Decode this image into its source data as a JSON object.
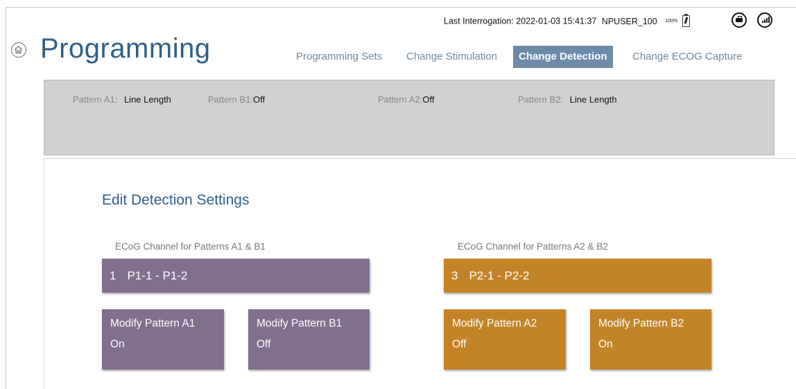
{
  "header": {
    "last_interrogation": "Last Interrogation: 2022-01-03 15:41:37",
    "user": "NPUSER_100",
    "battery_percent": "100%",
    "icons": [
      "toolbox-icon",
      "signal-icon",
      "home-icon",
      "battery-icon"
    ]
  },
  "page": {
    "title": "Programming"
  },
  "nav": {
    "tabs": [
      {
        "label": "Programming Sets",
        "active": false
      },
      {
        "label": "Change Stimulation",
        "active": false
      },
      {
        "label": "Change Detection",
        "active": true
      },
      {
        "label": "Change ECOG Capture",
        "active": false
      }
    ]
  },
  "summary": {
    "items": [
      {
        "label": "Pattern A1:",
        "value": "Line Length"
      },
      {
        "label": "Pattern B1:",
        "value": "Off"
      },
      {
        "label": "Pattern A2:",
        "value": "Off"
      },
      {
        "label": "Pattern B2:",
        "value": "Line Length"
      }
    ]
  },
  "detection": {
    "title": "Edit Detection Settings",
    "groups": [
      {
        "channel_label": "ECoG Channel for Patterns A1 & B1",
        "channel_number": "1",
        "channel_name": "P1-1 - P1-2",
        "color": "#826f8e",
        "tiles": [
          {
            "label": "Modify Pattern A1",
            "status": "On"
          },
          {
            "label": "Modify Pattern B1",
            "status": "Off"
          }
        ]
      },
      {
        "channel_label": "ECoG Channel for Patterns A2 & B2",
        "channel_number": "3",
        "channel_name": "P2-1 - P2-2",
        "color": "#c38428",
        "tiles": [
          {
            "label": "Modify Pattern A2",
            "status": "Off"
          },
          {
            "label": "Modify Pattern B2",
            "status": "On"
          }
        ]
      }
    ]
  },
  "colors": {
    "title_blue": "#2e5f89",
    "tab_inactive": "#6b89a3",
    "tab_active_bg": "#6d8aa8",
    "purple": "#826f8e",
    "orange": "#c38428",
    "panel_gray": "#d1d1d1"
  }
}
